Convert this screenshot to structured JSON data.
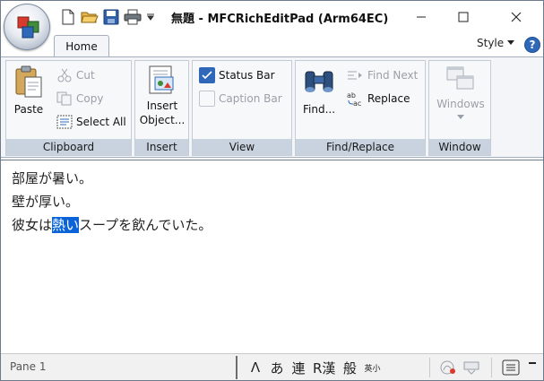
{
  "window": {
    "title": "無題 - MFCRichEditPad (Arm64EC)"
  },
  "tabs": [
    {
      "label": "Home",
      "active": true
    }
  ],
  "style_menu": {
    "label": "Style"
  },
  "help": {
    "label": "?"
  },
  "ribbon": {
    "clipboard": {
      "label": "Clipboard",
      "paste": "Paste",
      "cut": "Cut",
      "copy": "Copy",
      "select_all": "Select All"
    },
    "insert": {
      "label": "Insert",
      "insert_object_line1": "Insert",
      "insert_object_line2": "Object..."
    },
    "view": {
      "label": "View",
      "status_bar": "Status Bar",
      "status_bar_checked": true,
      "caption_bar": "Caption Bar",
      "caption_bar_checked": false
    },
    "find_replace": {
      "label": "Find/Replace",
      "find": "Find...",
      "find_next": "Find Next",
      "replace": "Replace"
    },
    "window": {
      "label": "Window",
      "windows": "Windows"
    }
  },
  "editor": {
    "lines": [
      {
        "text": "部屋が暑い。"
      },
      {
        "text": "壁が厚い。"
      },
      {
        "before": "彼女は",
        "selected": "熱い",
        "after": "スープを飲んでいた。"
      }
    ]
  },
  "statusbar": {
    "pane1": "Pane 1",
    "ime_buttons": [
      "Λ",
      "あ",
      "連",
      "R漢",
      "般",
      "英小"
    ]
  },
  "colors": {
    "accent": "#2f68b8",
    "selection": "#0a64d8",
    "group_label_bg": "#c8d3df"
  }
}
